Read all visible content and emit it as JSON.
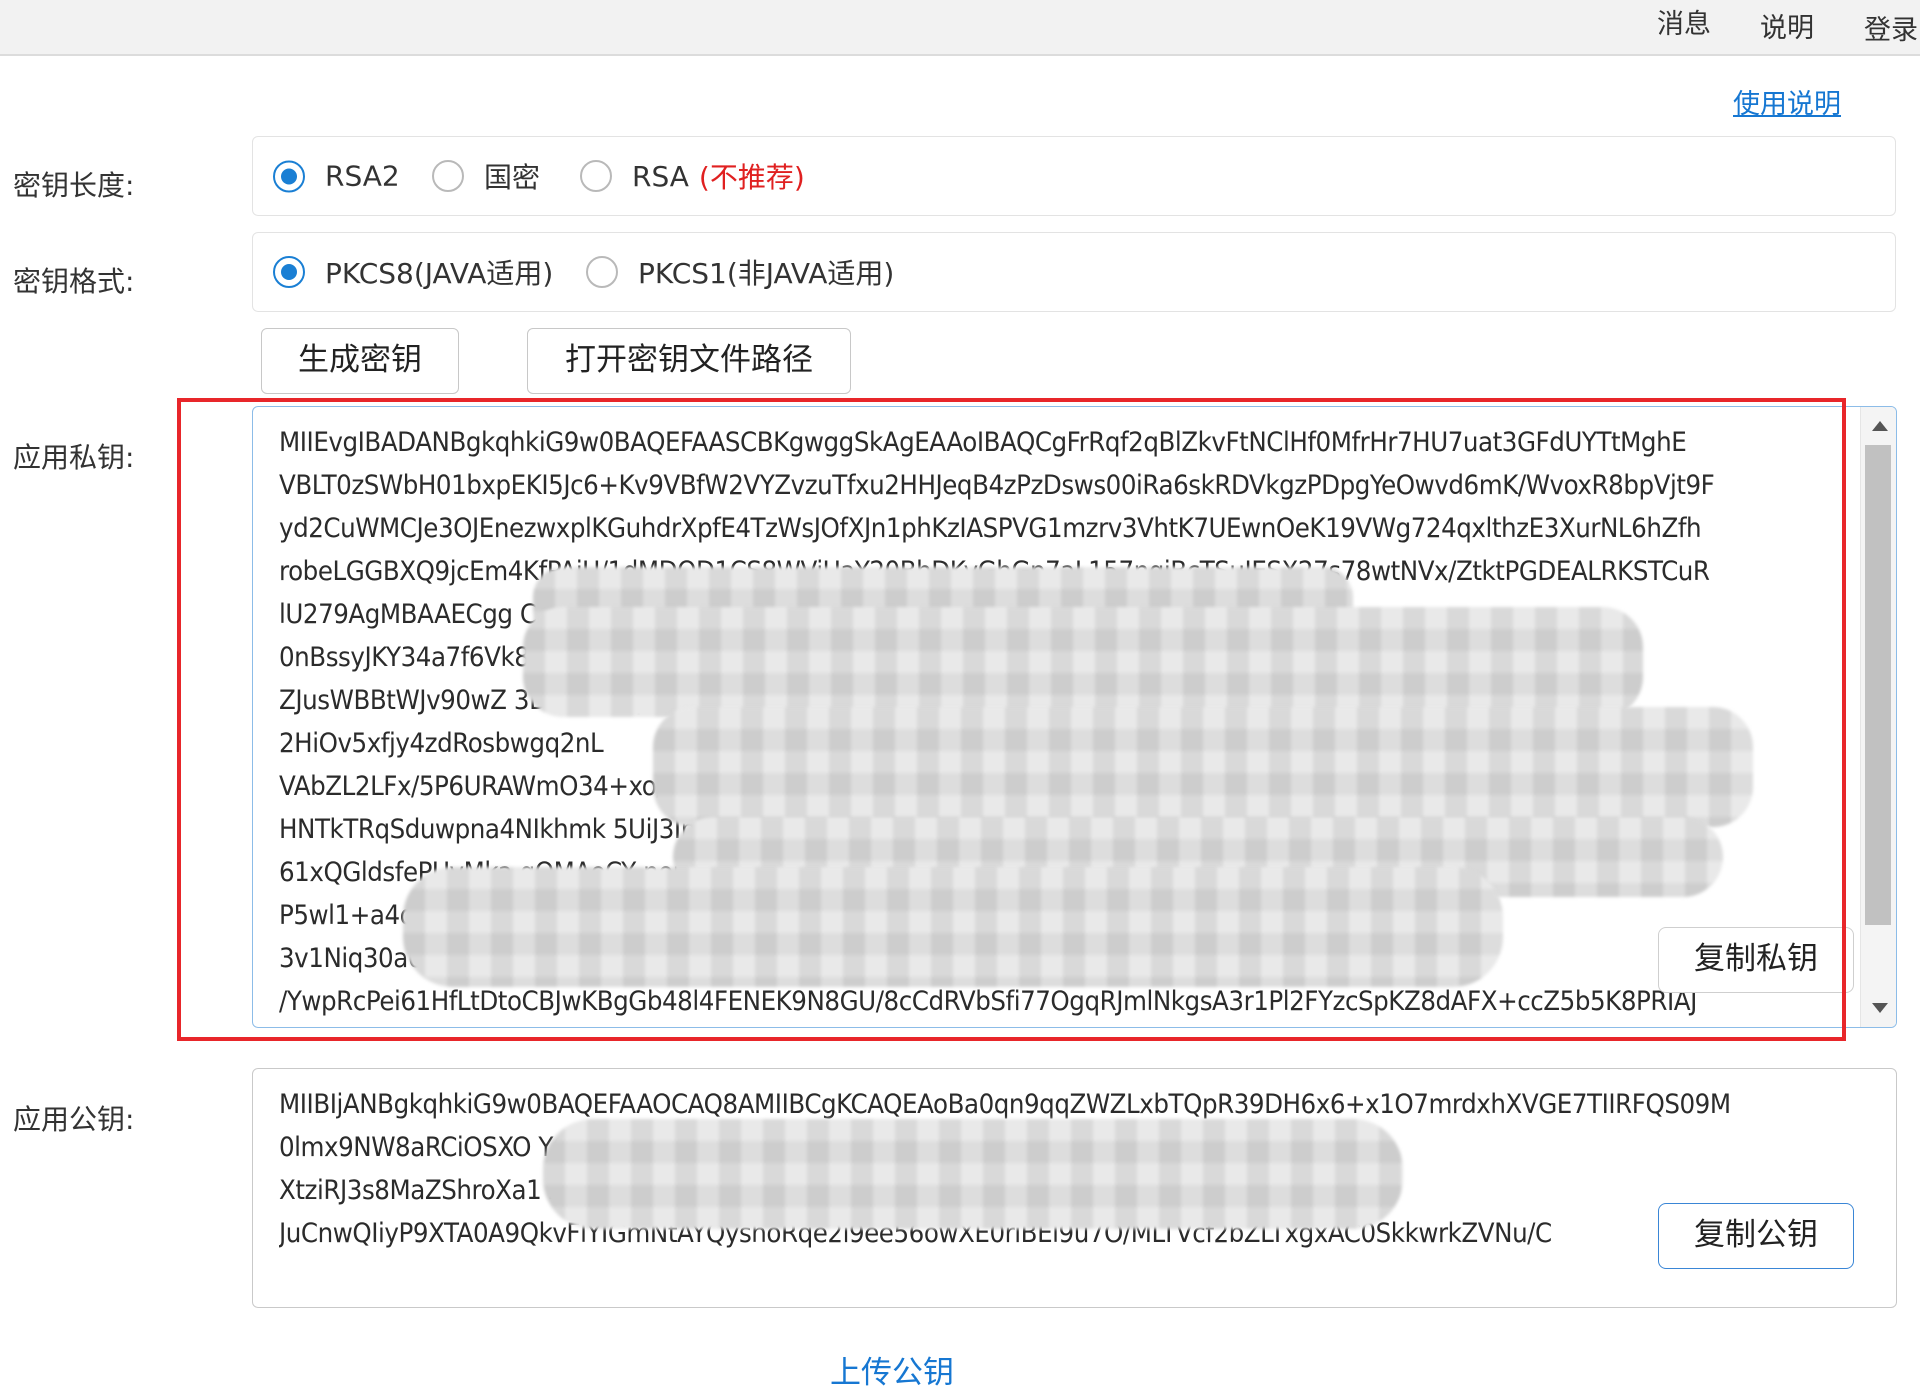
{
  "header": {
    "nav": [
      {
        "label": "消息"
      },
      {
        "label": "说明"
      },
      {
        "label": "登录"
      }
    ]
  },
  "help_link": "使用说明",
  "key_length": {
    "label": "密钥长度:",
    "options": [
      {
        "label": "RSA2",
        "checked": true
      },
      {
        "label": "国密",
        "checked": false
      },
      {
        "label": "RSA",
        "note": "(不推荐)",
        "checked": false
      }
    ]
  },
  "key_format": {
    "label": "密钥格式:",
    "options": [
      {
        "label": "PKCS8(JAVA适用)",
        "checked": true
      },
      {
        "label": "PKCS1(非JAVA适用)",
        "checked": false
      }
    ]
  },
  "actions": {
    "generate": "生成密钥",
    "open_path": "打开密钥文件路径"
  },
  "private_key": {
    "label": "应用私钥:",
    "copy": "复制私钥",
    "lines": [
      "MIIEvgIBADANBgkqhkiG9w0BAQEFAASCBKgwggSkAgEAAoIBAQCgFrRqf2qBlZkvFtNClHf0MfrHr7HU7uat3GFdUYTtMghE",
      "VBLT0zSWbH01bxpEKI5Jc6+Kv9VBfW2VYZvzuTfxu2HHJeqB4zPzDsws00iRa6skRDVkgzPDpgYeOwvd6mK/WvoxR8bpVjt9F",
      "yd2CuWMCJe3OJEnezwxplKGuhdrXpfE4TzWsJOfXJn1phKzIASPVG1mzrv3VhtK7UEwnOeK19VWg724qxlthzE3XurNL6hZfh",
      "robeLGGBXQ9jcEm4KfPAjU/1dMDOD1CS8WViUaY20BhDKyGhGp7aL157nqjBcTSuIESX27s78wtNVx/ZtktPGDEALRKSTCuR",
      "lU279AgMBAAECgg                                                                                         CAYeOMQHR21m3T9QeR9qBNz61SEc3akGO",
      "0nBssyJKY34a7f6Vk8                                                                                      mlbjXERooUn24p76pM3VxgLxj/Ix",
      "ZJusWBBtWJv90wZ                                                                                         3D80C8RqcOAHE6tbTv32INRhQzV",
      "2HiOv5xfjy4zdRosbwgq2nL                                                                                                     ",
      "VAbZL2LFx/5P6URAWmO34+xo/nFIHcQkRd                                                                                          ",
      "HNTkTRqSduwpna4NIkhmk                                                                                  5UiJ3Im5rIUZK2v3nqqZt3C5",
      "61xQGldsfePUvMka                                        qQMAeCY                                      nouS5MkquCgBGJMzs/R",
      "P5wl1+a4qE50                                                                                            MQcCTh7vlBUV6Owfdf1Xzi",
      "3v1Niq30a0/                                                                                              NH0rlf1hMGrRg0",
      "/YwpRcPei61HfLtDtoCBJwKBgGb48l4FENEK9N8GU/8cCdRVbSfi77OgqRJmlNkgsA3r1Pl2FYzcSpKZ8dAFX+ccZ5b5K8PRIAJ"
    ]
  },
  "public_key": {
    "label": "应用公钥:",
    "copy": "复制公钥",
    "lines": [
      "MIIBIjANBgkqhkiG9w0BAQEFAAOCAQ8AMIIBCgKCAQEAoBa0qn9qqZWZLxbTQpR39DH6x6+x1O7mrdxhXVGE7TIIRFQS09M",
      "0lmx9NW8aRCiOSXO                                                                                       YGHjsL3epiv1r6MUfG6VY7fRcndgrljAi",
      "XtziRJ3s8MaZShroXa1                                                                                     ZbYcxN17qzS+oWX4a6G3ixhqV0PY3B",
      "JuCnwQIiyP9XTA0A9QkvFlYIGmNtAYQyshoRqe2i9ee56owXE0riBEl9u7O/MLTVcf2bZLTxgxAC0SkkwrkZVNu/C"
    ]
  },
  "upload_link": "上传公钥"
}
